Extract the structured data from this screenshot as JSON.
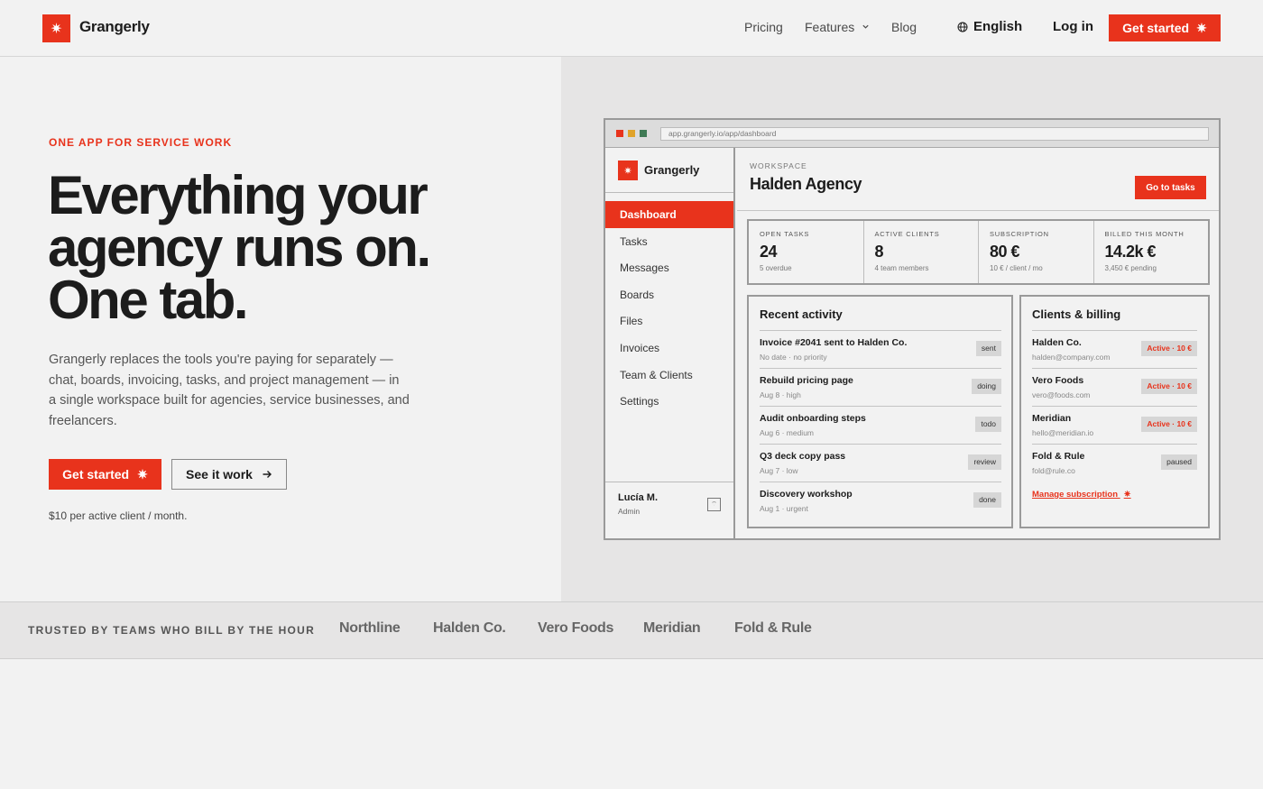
{
  "header": {
    "brand": "Grangerly",
    "logo_icon": "✷",
    "nav": {
      "pricing": "Pricing",
      "features": "Features",
      "blog": "Blog"
    },
    "language": "English",
    "login": "Log in",
    "cta": "Get started"
  },
  "hero": {
    "eyebrow": "ONE APP FOR SERVICE WORK",
    "headline": [
      "Everything your",
      "agency runs on.",
      "One tab."
    ],
    "lead": "Grangerly replaces the tools you're paying for separately — chat, boards, invoicing, tasks, and project management — in a single workspace built for agencies, service businesses, and freelancers.",
    "cta_primary": "Get started",
    "cta_secondary": "See it work",
    "price_note": "$10 per active client / month."
  },
  "app": {
    "url": "app.grangerly.io/app/dashboard",
    "brand": "Grangerly",
    "sidebar": [
      {
        "label": "Dashboard",
        "active": true
      },
      {
        "label": "Tasks"
      },
      {
        "label": "Messages"
      },
      {
        "label": "Boards"
      },
      {
        "label": "Files"
      },
      {
        "label": "Invoices"
      },
      {
        "label": "Team & Clients"
      },
      {
        "label": "Settings"
      }
    ],
    "user": {
      "name": "Lucía M.",
      "role": "Admin"
    },
    "workspace_label": "WORKSPACE",
    "workspace_name": "Halden Agency",
    "go_button": "Go to tasks",
    "stats": [
      {
        "label": "OPEN TASKS",
        "value": "24",
        "sub": "5 overdue"
      },
      {
        "label": "ACTIVE CLIENTS",
        "value": "8",
        "sub": "4 team members"
      },
      {
        "label": "SUBSCRIPTION",
        "value": "80 €",
        "sub": "10 € / client / mo"
      },
      {
        "label": "BILLED THIS MONTH",
        "value": "14.2k €",
        "sub": "3,450 € pending"
      }
    ],
    "activity": {
      "title": "Recent activity",
      "rows": [
        {
          "title": "Invoice #2041 sent to Halden Co.",
          "sub": "No date · no priority",
          "tag": "sent"
        },
        {
          "title": "Rebuild pricing page",
          "sub": "Aug 8 · high",
          "tag": "doing"
        },
        {
          "title": "Audit onboarding steps",
          "sub": "Aug 6 · medium",
          "tag": "todo"
        },
        {
          "title": "Q3 deck copy pass",
          "sub": "Aug 7 · low",
          "tag": "review"
        },
        {
          "title": "Discovery workshop",
          "sub": "Aug 1 · urgent",
          "tag": "done"
        }
      ]
    },
    "clients": {
      "title": "Clients & billing",
      "rows": [
        {
          "title": "Halden Co.",
          "sub": "halden@company.com",
          "tag": "Active · 10 €"
        },
        {
          "title": "Vero Foods",
          "sub": "vero@foods.com",
          "tag": "Active · 10 €"
        },
        {
          "title": "Meridian",
          "sub": "hello@meridian.io",
          "tag": "Active · 10 €"
        },
        {
          "title": "Fold & Rule",
          "sub": "fold@rule.co",
          "tag": "paused"
        }
      ],
      "manage": "Manage subscription"
    }
  },
  "trusted": {
    "label": "TRUSTED BY TEAMS WHO BILL BY THE HOUR",
    "logos": [
      "Northline",
      "Halden Co.",
      "Vero Foods",
      "Meridian",
      "Fold & Rule"
    ]
  },
  "colors": {
    "accent": "#e8331c",
    "dot_red": "#e8331c",
    "dot_yellow": "#e0a32a",
    "dot_green": "#3f7a55"
  }
}
